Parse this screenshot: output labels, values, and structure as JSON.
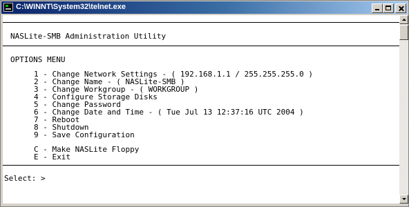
{
  "window": {
    "title": "C:\\WINNT\\System32\\telnet.exe",
    "icon": "console-icon"
  },
  "console": {
    "header": "NASLite-SMB Administration Utility",
    "menu_title": "OPTIONS MENU",
    "menu_items": [
      {
        "key": "1",
        "text": "Change Network Settings - ( 192.168.1.1 / 255.255.255.0 )"
      },
      {
        "key": "2",
        "text": "Change Name - ( NASLite-SMB )"
      },
      {
        "key": "3",
        "text": "Change Workgroup - ( WORKGROUP )"
      },
      {
        "key": "4",
        "text": "Configure Storage Disks"
      },
      {
        "key": "5",
        "text": "Change Password"
      },
      {
        "key": "6",
        "text": "Change Date and Time - ( Tue Jul 13 12:37:16 UTC 2004 )"
      },
      {
        "key": "7",
        "text": "Reboot"
      },
      {
        "key": "8",
        "text": "Shutdown"
      },
      {
        "key": "9",
        "text": "Save Configuration"
      }
    ],
    "extra_items": [
      {
        "key": "C",
        "text": "Make NASLite Floppy"
      },
      {
        "key": "E",
        "text": "Exit"
      }
    ],
    "prompt": "Select: >"
  }
}
